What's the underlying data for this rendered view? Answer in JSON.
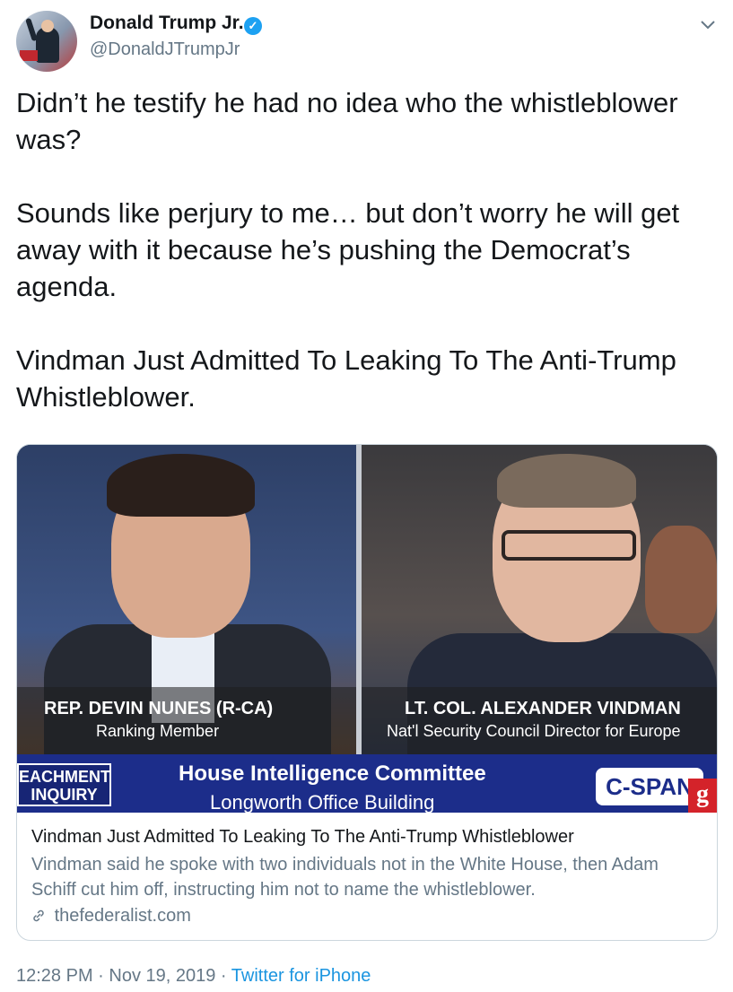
{
  "author": {
    "name": "Donald Trump Jr.",
    "handle": "@DonaldJTrumpJr",
    "verified": true,
    "avatar_icon": "avatar-photo"
  },
  "menu": {
    "icon": "chevron-down-icon"
  },
  "tweet": {
    "paragraphs": [
      "Didn’t he testify he had no idea who the whistleblower was?",
      "Sounds like perjury to me… but don’t worry he will get away with it because he’s pushing the Democrat’s agenda.",
      "Vindman Just Admitted To Leaking To The Anti-Trump Whistleblower."
    ]
  },
  "card": {
    "image": {
      "left_caption_title": "REP. DEVIN NUNES (R-CA)",
      "left_caption_sub": "Ranking Member",
      "right_caption_title": "LT. COL. ALEXANDER VINDMAN",
      "right_caption_sub": "Nat'l Security Council Director for Europe",
      "banner_left": "EACHMENT INQUIRY",
      "banner_title": "House Intelligence Committee",
      "banner_sub": "Longworth Office Building",
      "logo": "C-SPAN",
      "logo_badge": "g"
    },
    "title": "Vindman Just Admitted To Leaking To The Anti-Trump Whistleblower",
    "description": "Vindman said he spoke with two individuals not in the White House, then Adam Schiff cut him off, instructing him not to name the whistleblower.",
    "domain": "thefederalist.com",
    "link_icon": "link-icon"
  },
  "meta": {
    "time": "12:28 PM",
    "separator": " · ",
    "date": "Nov 19, 2019",
    "source": "Twitter for iPhone"
  },
  "colors": {
    "link": "#1b95e0",
    "verified": "#1da1f2",
    "secondary": "#657786",
    "border": "#ccd6dd"
  }
}
